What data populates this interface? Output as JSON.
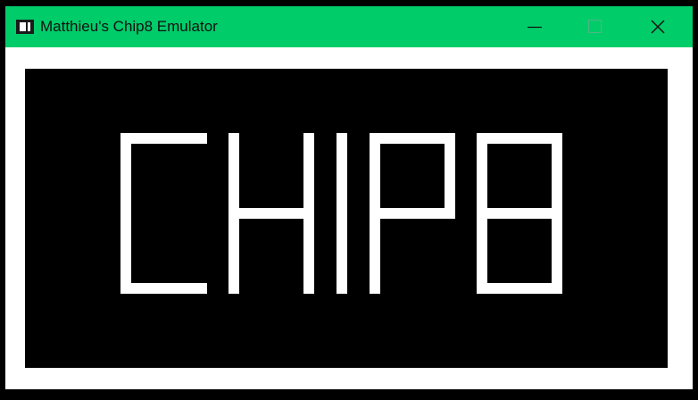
{
  "window": {
    "title": "Matthieu's Chip8 Emulator",
    "accent_color": "#00cc6a",
    "icons": {
      "app": "window-app-icon",
      "minimize": "minimize-icon",
      "maximize": "maximize-icon",
      "close": "close-icon"
    }
  },
  "display": {
    "text": "CHIP8",
    "foreground_color": "#ffffff",
    "background_color": "#000000"
  }
}
